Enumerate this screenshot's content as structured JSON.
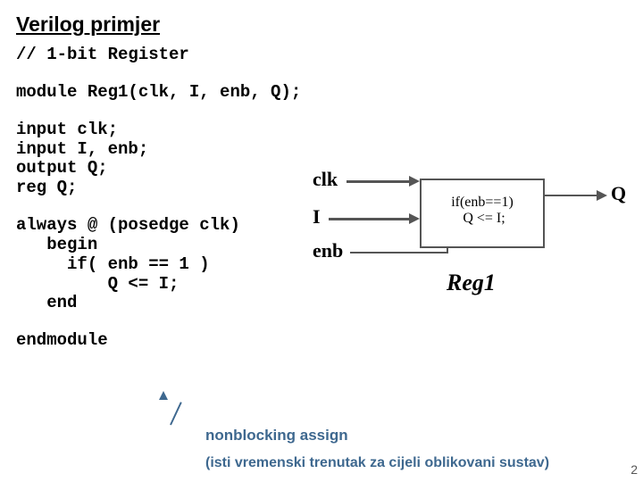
{
  "title": "Verilog primjer",
  "code": {
    "comment": "// 1-bit Register",
    "module_decl": "module Reg1(clk, I, enb, Q);",
    "decls": "input clk;\ninput I, enb;\noutput Q;\nreg Q;",
    "always": "always @ (posedge clk)\n   begin\n     if( enb == 1 )\n         Q <= I;\n   end",
    "endmodule": "endmodule"
  },
  "diagram": {
    "clk": "clk",
    "I": "I",
    "enb": "enb",
    "Q": "Q",
    "inner": "if(enb==1)\n Q <= I;",
    "reg_label": "Reg1"
  },
  "notes": {
    "nonblocking": "nonblocking assign",
    "explanation": "(isti vremenski trenutak za cijeli oblikovani sustav)"
  },
  "page_number": "2"
}
